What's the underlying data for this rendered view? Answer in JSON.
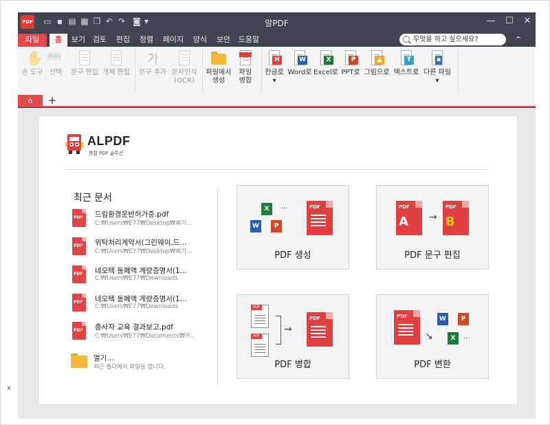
{
  "window": {
    "title": "알PDF",
    "logo_text": "PDF",
    "controls": {
      "minimize": "—",
      "maximize": "☐",
      "close": "✕"
    }
  },
  "menu": {
    "tabs": [
      {
        "label": "파일"
      },
      {
        "label": "홈"
      },
      {
        "label": "보기"
      },
      {
        "label": "검토"
      },
      {
        "label": "편집"
      },
      {
        "label": "정렬"
      },
      {
        "label": "페이지"
      },
      {
        "label": "양식"
      },
      {
        "label": "보안"
      },
      {
        "label": "도움말"
      }
    ],
    "search_placeholder": "무엇을 하고 싶으세요?",
    "collapse": "^"
  },
  "ribbon": {
    "buttons": [
      {
        "label": "손 도구"
      },
      {
        "label": "선택"
      },
      {
        "label": "문구 편집"
      },
      {
        "label": "개체 편집"
      },
      {
        "label": "문구 추가"
      },
      {
        "label": "문자인식",
        "label2": "(OCR)"
      },
      {
        "label": "파일에서",
        "label2": "생성"
      },
      {
        "label": "파일",
        "label2": "병합"
      },
      {
        "label": "한글로",
        "label2": "▾",
        "badge": "H"
      },
      {
        "label": "Word로",
        "badge": "W"
      },
      {
        "label": "Excel로",
        "badge": "X"
      },
      {
        "label": "PPT로",
        "badge": "P"
      },
      {
        "label": "그림으로"
      },
      {
        "label": "텍스트로",
        "badge": "T"
      },
      {
        "label": "다른 파일",
        "label2": "▾"
      }
    ],
    "select_icon_text": "가나다",
    "add_text_icon": "가"
  },
  "tabs": {
    "home_icon": "⌂",
    "add": "+"
  },
  "home": {
    "brand": "ALPDF",
    "brand_sub": "통합 PDF 솔루션",
    "recent_title": "최근 문서",
    "recent": [
      {
        "name": "드림환경운반허가증.pdf",
        "path": "C:₩Users₩E77₩Desktop₩폐기..."
      },
      {
        "name": "위탁처리계약서(그린웨이,드...",
        "path": "C:₩Users₩E77₩Desktop₩폐기..."
      },
      {
        "name": "네오텍 동폐액 계량증명서(1...",
        "path": "C:₩Users₩E77₩Downloads"
      },
      {
        "name": "네오텍 동폐액 계량증명서(1...",
        "path": "C:₩Users₩E77₩Downloads"
      },
      {
        "name": "종사자 교육 결과보고.pdf",
        "path": "C:₩Users₩E77₩Documents₩카..."
      }
    ],
    "open": {
      "title": "열기...",
      "desc": "최근 폴더에서 파일을 엽니다."
    },
    "cards": [
      {
        "label": "PDF 생성"
      },
      {
        "label": "PDF 문구 편집"
      },
      {
        "label": "PDF 병합"
      },
      {
        "label": "PDF 변환"
      }
    ],
    "pdf_tag": "PDF",
    "letter_a": "A",
    "letter_b": "B",
    "ellipsis": "···",
    "arrow_right": "→",
    "arrow_diag": "↘"
  },
  "colors": {
    "accent": "#e3494a",
    "chrome": "#3f4450"
  }
}
